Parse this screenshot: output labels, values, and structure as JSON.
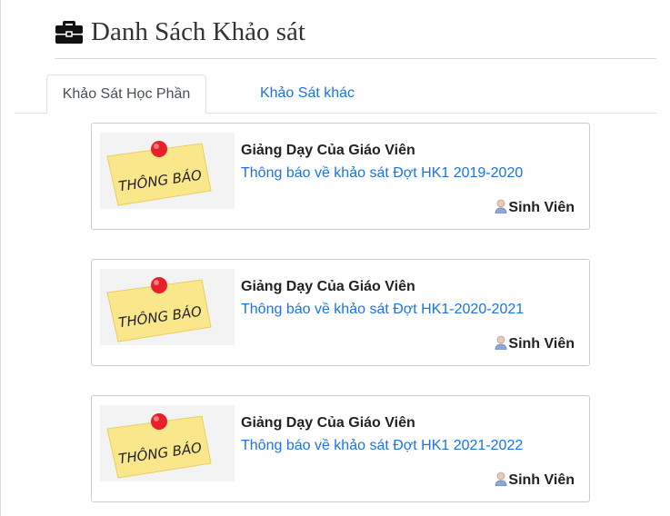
{
  "header": {
    "icon": "briefcase-icon",
    "title": "Danh Sách Khảo sát"
  },
  "tabs": [
    {
      "label": "Khảo Sát Học Phần",
      "active": true
    },
    {
      "label": "Khảo Sát khác",
      "active": false
    }
  ],
  "colors": {
    "link": "#1a73e8",
    "note_yellow": "#fbe78b",
    "pin_red": "#e8202a"
  },
  "thumbnail": {
    "icon": "notice-note-icon",
    "text": "THÔNG BÁO"
  },
  "surveys": [
    {
      "title": "Giảng Dạy Của Giáo Viên",
      "link": "Thông báo về khảo sát Đợt HK1 2019-2020",
      "audience": "Sinh Viên",
      "audience_icon": "user-icon"
    },
    {
      "title": "Giảng Dạy Của Giáo Viên",
      "link": "Thông báo về khảo sát Đợt HK1-2020-2021",
      "audience": "Sinh Viên",
      "audience_icon": "user-icon"
    },
    {
      "title": "Giảng Dạy Của Giáo Viên",
      "link": "Thông báo về khảo sát Đợt HK1 2021-2022",
      "audience": "Sinh Viên",
      "audience_icon": "user-icon"
    }
  ]
}
